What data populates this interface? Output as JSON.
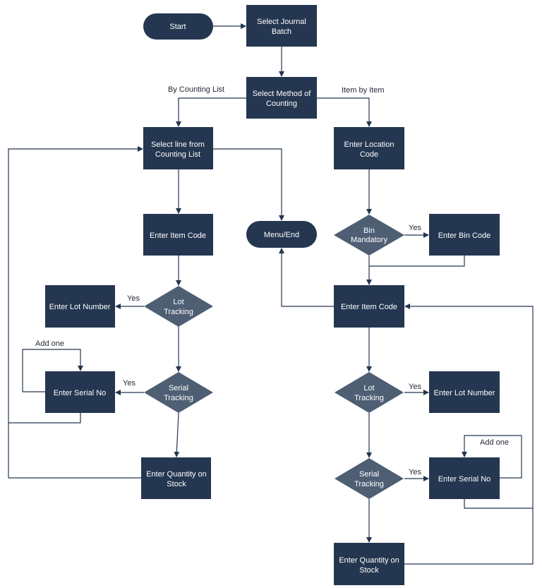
{
  "diagram": {
    "type": "flowchart",
    "colors": {
      "process": "#243650",
      "decision": "#4e5f74",
      "line": "#243650",
      "label": "#222a35",
      "text": "#ffffff"
    },
    "nodes": {
      "start": {
        "label_lines": [
          "Start"
        ],
        "shape": "terminator"
      },
      "select_journal_batch": {
        "label_lines": [
          "Select Journal",
          "Batch"
        ],
        "shape": "process"
      },
      "select_method": {
        "label_lines": [
          "Select Method of",
          "Counting"
        ],
        "shape": "process"
      },
      "select_line": {
        "label_lines": [
          "Select line from",
          "Counting List"
        ],
        "shape": "process"
      },
      "enter_location_code": {
        "label_lines": [
          "Enter Location",
          "Code"
        ],
        "shape": "process"
      },
      "enter_item_code_left": {
        "label_lines": [
          "Enter Item Code"
        ],
        "shape": "process"
      },
      "menu_end": {
        "label_lines": [
          "Menu/End"
        ],
        "shape": "terminator"
      },
      "bin_mandatory": {
        "label_lines": [
          "Bin",
          "Mandatory"
        ],
        "shape": "decision"
      },
      "enter_bin_code": {
        "label_lines": [
          "Enter Bin Code"
        ],
        "shape": "process"
      },
      "enter_lot_number_left": {
        "label_lines": [
          "Enter Lot Number"
        ],
        "shape": "process"
      },
      "lot_tracking_left": {
        "label_lines": [
          "Lot",
          "Tracking"
        ],
        "shape": "decision"
      },
      "enter_item_code_right": {
        "label_lines": [
          "Enter Item Code"
        ],
        "shape": "process"
      },
      "enter_serial_no_left": {
        "label_lines": [
          "Enter Serial No"
        ],
        "shape": "process"
      },
      "serial_tracking_left": {
        "label_lines": [
          "Serial",
          "Tracking"
        ],
        "shape": "decision"
      },
      "lot_tracking_right": {
        "label_lines": [
          "Lot",
          "Tracking"
        ],
        "shape": "decision"
      },
      "enter_lot_number_right": {
        "label_lines": [
          "Enter Lot Number"
        ],
        "shape": "process"
      },
      "enter_quantity_left": {
        "label_lines": [
          "Enter Quantity on",
          "Stock"
        ],
        "shape": "process"
      },
      "serial_tracking_right": {
        "label_lines": [
          "Serial",
          "Tracking"
        ],
        "shape": "decision"
      },
      "enter_serial_no_right": {
        "label_lines": [
          "Enter Serial No"
        ],
        "shape": "process"
      },
      "enter_quantity_right": {
        "label_lines": [
          "Enter Quantity on",
          "Stock"
        ],
        "shape": "process"
      }
    },
    "edge_labels": {
      "by_counting_list": "By Counting List",
      "item_by_item": "Item by Item",
      "yes_bin": "Yes",
      "yes_lot_left": "Yes",
      "yes_serial_left": "Yes",
      "yes_lot_right": "Yes",
      "yes_serial_right": "Yes",
      "add_one_left": "Add one",
      "add_one_right": "Add one"
    },
    "edges": [
      {
        "from": "start",
        "to": "select_journal_batch"
      },
      {
        "from": "select_journal_batch",
        "to": "select_method"
      },
      {
        "from": "select_method",
        "to": "select_line",
        "label": "By Counting List"
      },
      {
        "from": "select_method",
        "to": "enter_location_code",
        "label": "Item by Item"
      },
      {
        "from": "select_line",
        "to": "enter_item_code_left"
      },
      {
        "from": "select_line",
        "to": "menu_end"
      },
      {
        "from": "enter_item_code_left",
        "to": "lot_tracking_left"
      },
      {
        "from": "lot_tracking_left",
        "to": "enter_lot_number_left",
        "label": "Yes"
      },
      {
        "from": "lot_tracking_left",
        "to": "serial_tracking_left"
      },
      {
        "from": "serial_tracking_left",
        "to": "enter_serial_no_left",
        "label": "Yes"
      },
      {
        "from": "enter_serial_no_left",
        "to": "enter_serial_no_left",
        "label": "Add one"
      },
      {
        "from": "enter_serial_no_left",
        "to": "select_line"
      },
      {
        "from": "serial_tracking_left",
        "to": "enter_quantity_left"
      },
      {
        "from": "enter_quantity_left",
        "to": "select_line"
      },
      {
        "from": "enter_location_code",
        "to": "bin_mandatory"
      },
      {
        "from": "bin_mandatory",
        "to": "enter_bin_code",
        "label": "Yes"
      },
      {
        "from": "bin_mandatory",
        "to": "enter_item_code_right"
      },
      {
        "from": "enter_bin_code",
        "to": "enter_item_code_right"
      },
      {
        "from": "enter_item_code_right",
        "to": "menu_end"
      },
      {
        "from": "enter_item_code_right",
        "to": "lot_tracking_right"
      },
      {
        "from": "lot_tracking_right",
        "to": "enter_lot_number_right",
        "label": "Yes"
      },
      {
        "from": "lot_tracking_right",
        "to": "serial_tracking_right"
      },
      {
        "from": "serial_tracking_right",
        "to": "enter_serial_no_right",
        "label": "Yes"
      },
      {
        "from": "enter_serial_no_right",
        "to": "enter_serial_no_right",
        "label": "Add one"
      },
      {
        "from": "enter_serial_no_right",
        "to": "enter_item_code_right"
      },
      {
        "from": "serial_tracking_right",
        "to": "enter_quantity_right"
      },
      {
        "from": "enter_quantity_right",
        "to": "enter_item_code_right"
      }
    ]
  }
}
